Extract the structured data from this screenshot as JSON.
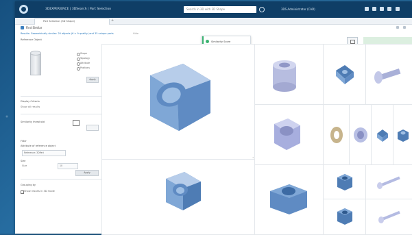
{
  "app": {
    "title": "3DEXPERIENCE | 3DSearch | Part Selection",
    "search_placeholder": "Search in 3D with 3D Shape",
    "user": "3DS Administrator (CAD)"
  },
  "tabs": [
    {
      "label": "Part Selection (3D Shape)"
    }
  ],
  "header": {
    "title": "Find Similar"
  },
  "results": {
    "summary": "Results: Geometrically similar: 20 objects (6 > 9 quality) and 35 unique parts",
    "hide_label": "Hide"
  },
  "popup": {
    "items": [
      {
        "label": "Similarity Score",
        "color": "#3cb371"
      },
      {
        "label": "Reference Object Info",
        "color": "#3a7fc0"
      }
    ]
  },
  "sidebar": {
    "reference_label": "Reference Object",
    "radio_options": [
      "Shape",
      "Topology",
      "Attribute",
      "Positions"
    ],
    "apply_label": "Apply",
    "display_label": "Display Criteria",
    "display_value": "Show all results",
    "threshold_label": "Similarity threshold",
    "filter_label": "Filter",
    "filter_sub": "Attribute of reference object",
    "filter_value": "Reference: 3DPart",
    "size_label": "Size",
    "size_field": "Size",
    "size_value": "10",
    "size_apply": "Apply",
    "grouping_label": "Grouping by",
    "grouping_check": "Show results in 3D mode"
  },
  "grid": {
    "colors": {
      "part": "#7fa7d6",
      "part_dark": "#4e7cb4",
      "part_light": "#b7cdea",
      "bore": "#5f8bc3",
      "washer": "#b9a37c"
    }
  }
}
